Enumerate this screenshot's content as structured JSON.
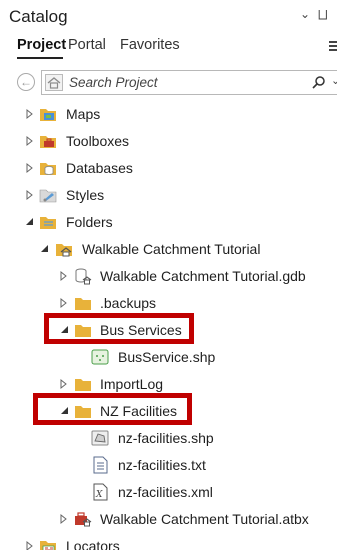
{
  "pane": {
    "title": "Catalog",
    "options_glyph": "⌄",
    "pin_glyph": "⨆"
  },
  "tabs": [
    {
      "label": "Project",
      "active": true
    },
    {
      "label": "Portal",
      "active": false
    },
    {
      "label": "Favorites",
      "active": false
    }
  ],
  "search": {
    "placeholder": "Search Project",
    "value": ""
  },
  "tree": {
    "maps": "Maps",
    "toolboxes": "Toolboxes",
    "databases": "Databases",
    "styles": "Styles",
    "folders": "Folders",
    "walkable_folder": "Walkable Catchment Tutorial",
    "walkable_gdb": "Walkable Catchment Tutorial.gdb",
    "backups": ".backups",
    "bus_services": "Bus Services",
    "bus_service_shp": "BusService.shp",
    "import_log": "ImportLog",
    "nz_facilities": "NZ Facilities",
    "nz_facilities_shp": "nz-facilities.shp",
    "nz_facilities_txt": "nz-facilities.txt",
    "nz_facilities_xml": "nz-facilities.xml",
    "walkable_atbx": "Walkable Catchment Tutorial.atbx",
    "locators": "Locators"
  },
  "colors": {
    "highlight": "#c00000",
    "folder": "#e8b23a"
  }
}
